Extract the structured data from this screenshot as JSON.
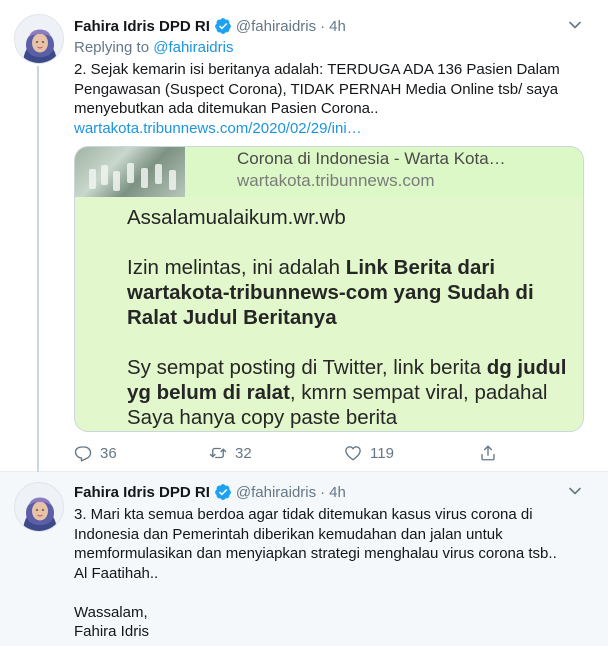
{
  "tweets": [
    {
      "author": {
        "name": "Fahira Idris DPD RI",
        "handle": "@fahiraidris"
      },
      "separator": "·",
      "time": "4h",
      "reply_prefix": "Replying to",
      "reply_handle": "@fahiraidris",
      "lines": [
        "2. Sejak kemarin isi beritanya adalah: TERDUGA ADA 136 Pasien Dalam",
        "Pengawasan (Suspect Corona), TIDAK PERNAH Media Online tsb/ saya",
        "menyebutkan ada ditemukan Pasien Corona.."
      ],
      "link": "wartakota.tribunnews.com/2020/02/29/ini…",
      "card": {
        "title": "Corona di Indonesia - Warta Kota…",
        "domain": "wartakota.tribunnews.com",
        "p1": "Assalamualaikum.wr.wb",
        "p2_intro": "Izin melintas, ini adalah ",
        "p2_bold": "Link Berita dari wartakota-tribunnews-com yang Sudah di Ralat Judul Beritanya",
        "p3_intro": "Sy sempat posting di Twitter, link berita ",
        "p3_bold": "dg judul yg belum di ralat",
        "p3_rest": ", kmrn sempat viral, padahal Saya hanya copy paste berita"
      },
      "counts": {
        "replies": "36",
        "retweets": "32",
        "likes": "119"
      }
    },
    {
      "author": {
        "name": "Fahira Idris DPD RI",
        "handle": "@fahiraidris"
      },
      "separator": "·",
      "time": "4h",
      "lines": [
        "3. Mari kta semua berdoa agar tidak ditemukan kasus virus corona di",
        "Indonesia dan Pemerintah diberikan kemudahan dan jalan untuk",
        "memformulasikan dan menyiapkan strategi menghalau virus corona tsb..",
        "Al Faatihah..",
        "",
        "Wassalam,",
        "Fahira Idris"
      ]
    }
  ],
  "icons": {
    "verified": "verified-badge-icon",
    "caret": "chevron-down-icon",
    "reply": "reply-icon",
    "retweet": "retweet-icon",
    "like": "heart-icon",
    "share": "share-icon"
  },
  "colors": {
    "link": "#1b95e0",
    "muted": "#657786",
    "card_bg": "#e2f7cb",
    "thread_line": "#ccd6dd"
  }
}
